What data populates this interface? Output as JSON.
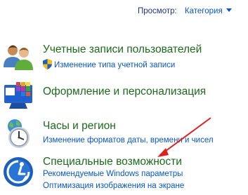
{
  "header": {
    "view_label": "Просмотр:",
    "view_value": "Категория"
  },
  "categories": [
    {
      "title": "Учетные записи пользователей",
      "links": [
        "Изменение типа учетной записи"
      ]
    },
    {
      "title": "Оформление и персонализация",
      "links": []
    },
    {
      "title": "Часы и регион",
      "links": [
        "Изменение форматов даты, времени и чисел"
      ]
    },
    {
      "title": "Специальные возможности",
      "links": [
        "Рекомендуемые Windows параметры",
        "Оптимизация изображения на экране"
      ]
    }
  ],
  "icons": [
    "users-icon",
    "uac-shield-icon",
    "display-palette-icon",
    "clock-globe-icon",
    "ease-of-access-icon"
  ],
  "colors": {
    "title_green": "#1b6a1b",
    "link_blue": "#0a56c4",
    "header_blue": "#1e3287",
    "annotation_arrow": "#e02020"
  }
}
